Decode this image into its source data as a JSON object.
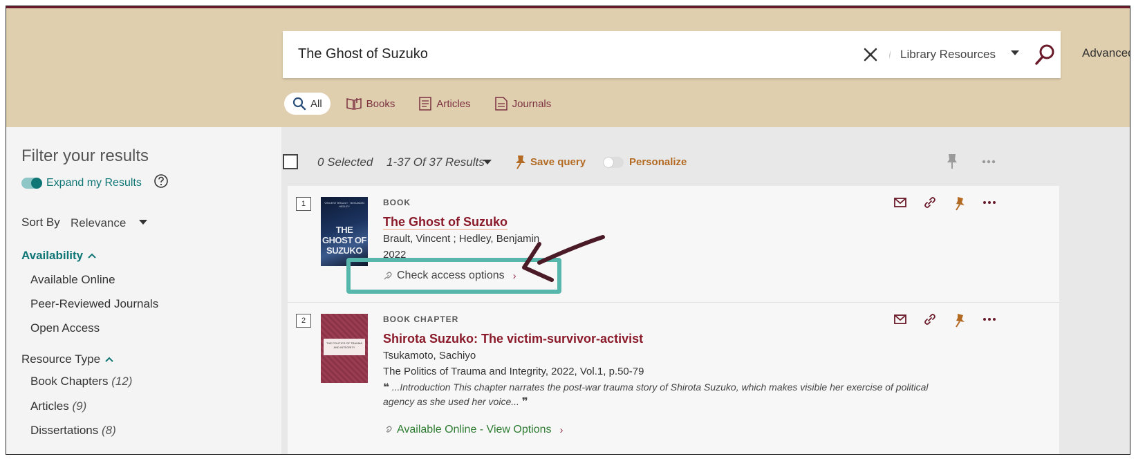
{
  "header": {
    "search_value": "The Ghost of Suzuko",
    "scope": "Library Resources",
    "advanced_label": "Advanced",
    "tabs": [
      {
        "label": "All",
        "icon": "search-icon"
      },
      {
        "label": "Books",
        "icon": "book-icon"
      },
      {
        "label": "Articles",
        "icon": "article-icon"
      },
      {
        "label": "Journals",
        "icon": "journal-icon"
      }
    ]
  },
  "sidebar": {
    "title": "Filter your results",
    "expand_label": "Expand my Results",
    "sort_label": "Sort By",
    "sort_value": "Relevance",
    "availability_head": "Availability",
    "availability": [
      "Available Online",
      "Peer-Reviewed Journals",
      "Open Access"
    ],
    "resource_type_head": "Resource Type",
    "resource_types": [
      {
        "label": "Book Chapters",
        "count": "(12)"
      },
      {
        "label": "Articles",
        "count": "(9)"
      },
      {
        "label": "Dissertations",
        "count": "(8)"
      }
    ]
  },
  "toolbar": {
    "selected": "0 Selected",
    "results": "1-37 Of 37 Results",
    "save_query": "Save query",
    "personalize": "Personalize"
  },
  "results": [
    {
      "num": "1",
      "type": "BOOK",
      "title": "The Ghost of Suzuko",
      "authors": "Brault, Vincent ; Hedley, Benjamin",
      "year": "2022",
      "access": "Check access options",
      "cover_title": "THE GHOST OF SUZUKO",
      "cover_sub": "VINCENT BRAULT · BENJAMIN HEDLEY"
    },
    {
      "num": "2",
      "type": "BOOK CHAPTER",
      "title": "Shirota Suzuko: The victim-survivor-activist",
      "authors": "Tsukamoto, Sachiyo",
      "source": "The Politics of Trauma and Integrity, 2022, Vol.1, p.50-79",
      "snippet": "...Introduction This chapter narrates the post-war trauma story of Shirota Suzuko, which makes visible her exercise of political agency as she used her voice...",
      "access": "Available Online - View Options",
      "cover_title": "THE POLITICS OF TRAUMA AND INTEGRITY"
    }
  ],
  "colors": {
    "header_bg": "#e0cfae",
    "title_red": "#8b1a2b",
    "teal": "#0f7575",
    "orange": "#b36a22",
    "annotation": "#58b7ad",
    "arrow": "#4a1a26"
  }
}
